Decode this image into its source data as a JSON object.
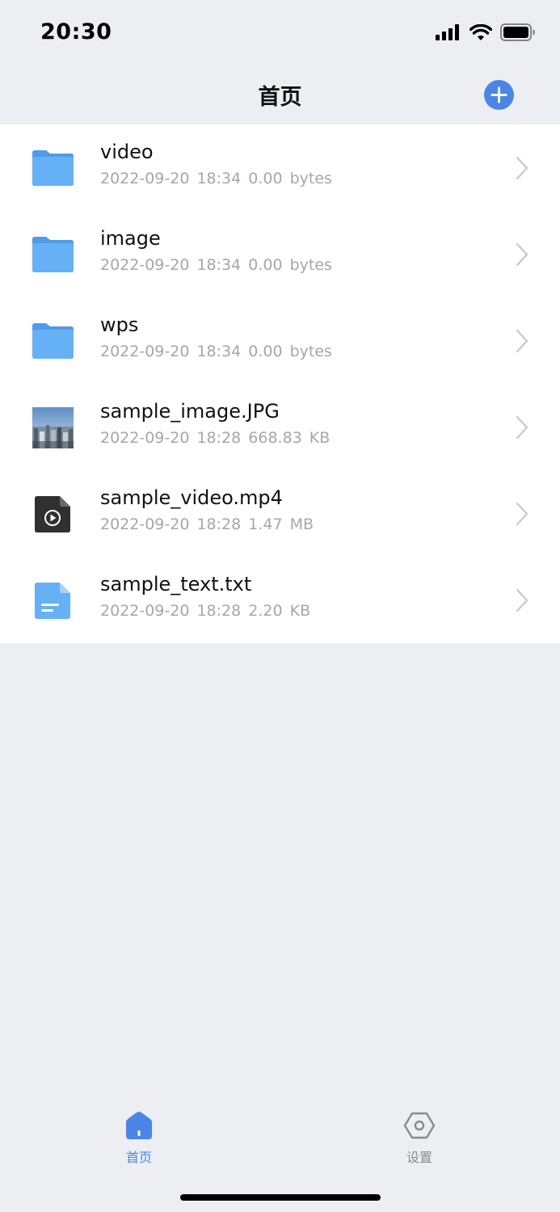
{
  "status_bar": {
    "time": "20:30"
  },
  "nav": {
    "title": "首页"
  },
  "files": [
    {
      "name": "video",
      "date": "2022-09-20 18:34",
      "size": "0.00 bytes",
      "icon": "folder-icon"
    },
    {
      "name": "image",
      "date": "2022-09-20 18:34",
      "size": "0.00 bytes",
      "icon": "folder-icon"
    },
    {
      "name": "wps",
      "date": "2022-09-20 18:34",
      "size": "0.00 bytes",
      "icon": "folder-icon"
    },
    {
      "name": "sample_image.JPG",
      "date": "2022-09-20 18:28",
      "size": "668.83 KB",
      "icon": "image-thumbnail"
    },
    {
      "name": "sample_video.mp4",
      "date": "2022-09-20 18:28",
      "size": "1.47 MB",
      "icon": "video-file-icon"
    },
    {
      "name": "sample_text.txt",
      "date": "2022-09-20 18:28",
      "size": "2.20 KB",
      "icon": "text-file-icon"
    }
  ],
  "tabs": [
    {
      "label": "首页",
      "icon": "home-icon",
      "active": true
    },
    {
      "label": "设置",
      "icon": "settings-icon",
      "active": false
    }
  ],
  "colors": {
    "accent": "#4a86e8",
    "folder": "#64aef5",
    "background": "#edeef2",
    "meta_text": "#a6a6ab"
  }
}
